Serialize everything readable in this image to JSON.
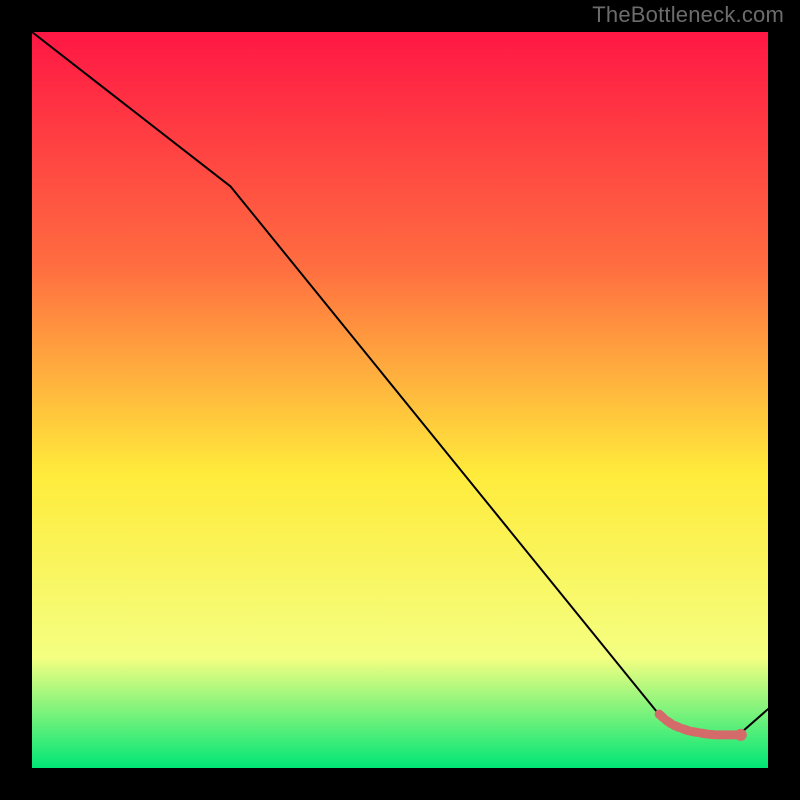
{
  "watermark": "TheBottleneck.com",
  "colors": {
    "background": "#000000",
    "gradient_top": "#ff1744",
    "gradient_mid_upper": "#ff6e40",
    "gradient_mid": "#ffeb3b",
    "gradient_low": "#f4ff81",
    "gradient_bottom": "#00e676",
    "curve": "#000000",
    "marker_fill": "#d46a6a",
    "marker_stroke": "#d46a6a"
  },
  "chart_data": {
    "type": "line",
    "title": "",
    "xlabel": "",
    "ylabel": "",
    "xlim": [
      0,
      100
    ],
    "ylim": [
      0,
      100
    ],
    "series": [
      {
        "name": "bottleneck-curve",
        "x": [
          0,
          27,
          85,
          87,
          90,
          92.5,
          96,
          100
        ],
        "values": [
          100,
          79,
          7.5,
          5.8,
          4.8,
          4.5,
          4.5,
          8
        ]
      }
    ],
    "markers": {
      "name": "highlighted-range",
      "x": [
        85,
        86,
        87,
        88.2,
        89.4,
        90.6,
        91.8,
        93,
        94.2,
        95.4,
        96.3
      ],
      "values": [
        7.5,
        6.6,
        5.9,
        5.4,
        5.0,
        4.8,
        4.6,
        4.5,
        4.5,
        4.5,
        4.5
      ]
    }
  }
}
